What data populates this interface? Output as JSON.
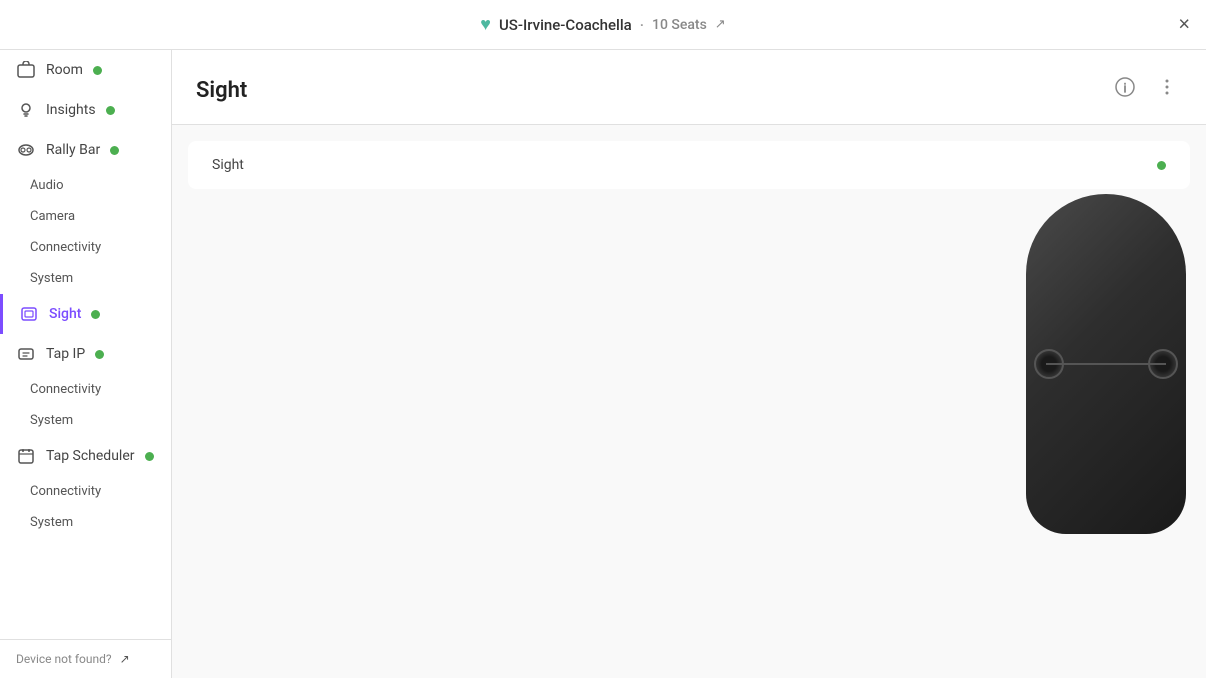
{
  "header": {
    "logo_icon": "heart-icon",
    "title": "US-Irvine-Coachella",
    "dot": "·",
    "seats": "10 Seats",
    "edit_icon": "external-link-icon",
    "close_icon": "×"
  },
  "sidebar": {
    "top_items": [
      {
        "id": "room",
        "label": "Room",
        "icon": "room-icon",
        "has_status": true,
        "status": "green",
        "active": false
      },
      {
        "id": "insights",
        "label": "Insights",
        "icon": "bulb-icon",
        "has_status": true,
        "status": "green",
        "active": false
      },
      {
        "id": "rally-bar",
        "label": "Rally Bar",
        "icon": "camera-icon",
        "has_status": true,
        "status": "green",
        "active": false
      }
    ],
    "rally_bar_sub": [
      {
        "id": "audio",
        "label": "Audio"
      },
      {
        "id": "camera",
        "label": "Camera"
      },
      {
        "id": "connectivity-rb",
        "label": "Connectivity"
      },
      {
        "id": "system-rb",
        "label": "System"
      }
    ],
    "sight": {
      "id": "sight",
      "label": "Sight",
      "icon": "sight-icon",
      "has_status": true,
      "status": "green",
      "active": true
    },
    "tap_ip": {
      "id": "tap-ip",
      "label": "Tap IP",
      "icon": "tap-icon",
      "has_status": true,
      "status": "green",
      "active": false
    },
    "tap_ip_sub": [
      {
        "id": "connectivity-tap",
        "label": "Connectivity"
      },
      {
        "id": "system-tap",
        "label": "System"
      }
    ],
    "tap_scheduler": {
      "id": "tap-scheduler",
      "label": "Tap Scheduler",
      "icon": "scheduler-icon",
      "has_status": true,
      "status": "green",
      "active": false
    },
    "tap_scheduler_sub": [
      {
        "id": "connectivity-sched",
        "label": "Connectivity"
      },
      {
        "id": "system-sched",
        "label": "System"
      }
    ],
    "bottom": {
      "label": "Device not found?",
      "link_icon": "external-link-icon"
    }
  },
  "content": {
    "title": "Sight",
    "info_icon": "info-icon",
    "more_icon": "more-icon",
    "device_row": {
      "label": "Sight",
      "status": "green"
    }
  }
}
